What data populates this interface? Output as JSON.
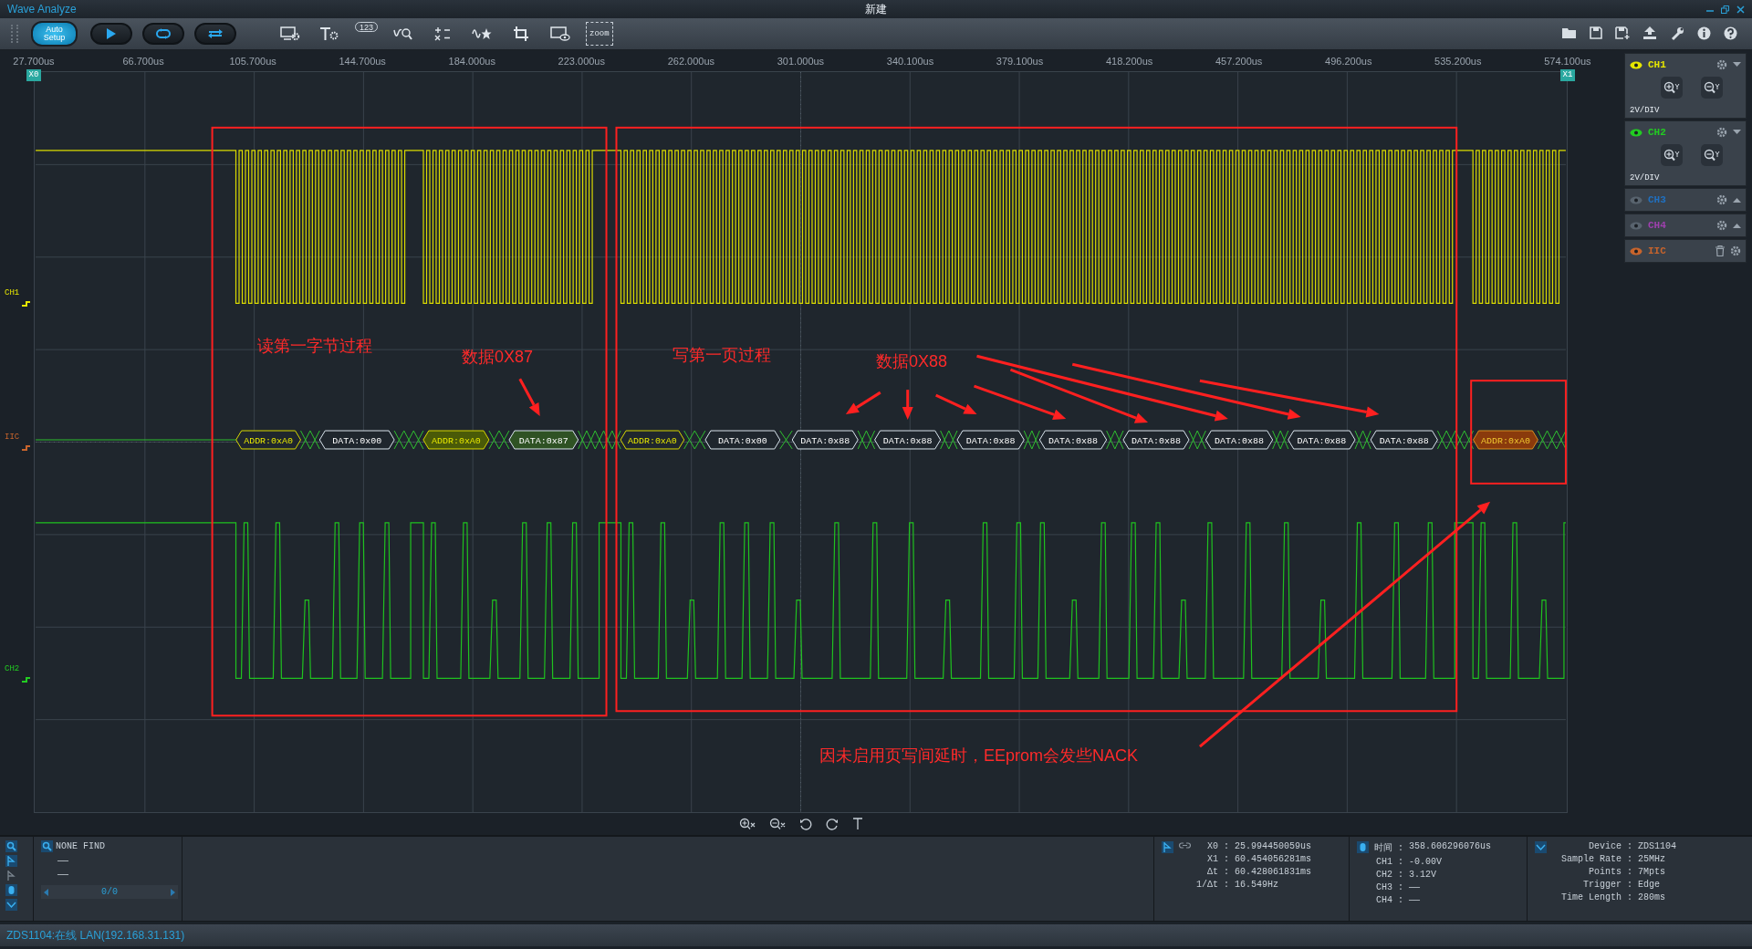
{
  "window": {
    "app_title": "Wave Analyze",
    "document_title": "新建"
  },
  "toolbar": {
    "auto_setup": "Auto Setup",
    "counter_badge": "123",
    "zoom_badge": "zoom"
  },
  "time_axis": {
    "labels": [
      "27.700us",
      "66.700us",
      "105.700us",
      "144.700us",
      "184.000us",
      "223.000us",
      "262.000us",
      "301.000us",
      "340.100us",
      "379.100us",
      "418.200us",
      "457.200us",
      "496.200us",
      "535.200us",
      "574.100us"
    ]
  },
  "cursors": [
    {
      "label": "X0"
    },
    {
      "label": "X1"
    }
  ],
  "trace_labels": [
    {
      "name": "CH1",
      "color": "#e6e600"
    },
    {
      "name": "IIC",
      "color": "#c8642c"
    },
    {
      "name": "CH2",
      "color": "#22cc22"
    }
  ],
  "decode": {
    "segments": [
      {
        "kind": "addr",
        "label": "ADDR:0xA0",
        "highlighted": false,
        "error": false
      },
      {
        "kind": "data",
        "label": "DATA:0x00",
        "highlighted": false,
        "error": false
      },
      {
        "kind": "addr",
        "label": "ADDR:0xA0",
        "highlighted": true,
        "error": false
      },
      {
        "kind": "data",
        "label": "DATA:0x87",
        "highlighted": true,
        "error": false
      },
      {
        "kind": "addr",
        "label": "ADDR:0xA0",
        "highlighted": false,
        "error": false
      },
      {
        "kind": "data",
        "label": "DATA:0x00",
        "highlighted": false,
        "error": false
      },
      {
        "kind": "data",
        "label": "DATA:0x88",
        "highlighted": false,
        "error": false
      },
      {
        "kind": "data",
        "label": "DATA:0x88",
        "highlighted": false,
        "error": false
      },
      {
        "kind": "data",
        "label": "DATA:0x88",
        "highlighted": false,
        "error": false
      },
      {
        "kind": "data",
        "label": "DATA:0x88",
        "highlighted": false,
        "error": false
      },
      {
        "kind": "data",
        "label": "DATA:0x88",
        "highlighted": false,
        "error": false
      },
      {
        "kind": "data",
        "label": "DATA:0x88",
        "highlighted": false,
        "error": false
      },
      {
        "kind": "data",
        "label": "DATA:0x88",
        "highlighted": false,
        "error": false
      },
      {
        "kind": "data",
        "label": "DATA:0x88",
        "highlighted": false,
        "error": false
      },
      {
        "kind": "addr",
        "label": "ADDR:0xA0",
        "highlighted": false,
        "error": true
      }
    ]
  },
  "annotations": [
    {
      "text": "读第一字节过程"
    },
    {
      "text": "数据0X87"
    },
    {
      "text": "写第一页过程"
    },
    {
      "text": "数据0X88"
    },
    {
      "text": "因未启用页写间延时，EEprom会发些NACK"
    }
  ],
  "channels": [
    {
      "name": "CH1",
      "kind": "analog",
      "visible": true,
      "expanded": true,
      "color": "#e6e600",
      "scale": "2V/DIV"
    },
    {
      "name": "CH2",
      "kind": "analog",
      "visible": true,
      "expanded": true,
      "color": "#22cc22",
      "scale": "2V/DIV"
    },
    {
      "name": "CH3",
      "kind": "analog",
      "visible": false,
      "expanded": false,
      "color": "#2070c0"
    },
    {
      "name": "CH4",
      "kind": "analog",
      "visible": false,
      "expanded": false,
      "color": "#a040b0"
    },
    {
      "name": "IIC",
      "kind": "bus",
      "visible": true,
      "expanded": false,
      "color": "#c8642c"
    }
  ],
  "search": {
    "status": "NONE FIND",
    "lines": [
      "——",
      "——"
    ],
    "page": "0/0"
  },
  "cursor_readout": [
    {
      "label": "X0 :",
      "value": "25.994450059us"
    },
    {
      "label": "X1 :",
      "value": "60.454056281ms"
    },
    {
      "label": "Δt :",
      "value": "60.428061831ms"
    },
    {
      "label": "1/Δt :",
      "value": "16.549Hz"
    }
  ],
  "probe_readout": [
    {
      "label": "时间 :",
      "value": "358.606296076us"
    },
    {
      "label": "CH1 :",
      "value": "-0.00V"
    },
    {
      "label": "CH2 :",
      "value": "3.12V"
    },
    {
      "label": "CH3 :",
      "value": "——"
    },
    {
      "label": "CH4 :",
      "value": "——"
    }
  ],
  "device_info": [
    {
      "label": "Device :",
      "value": "ZDS1104"
    },
    {
      "label": "Sample Rate :",
      "value": "25MHz"
    },
    {
      "label": "Points :",
      "value": "7Mpts"
    },
    {
      "label": "Trigger :",
      "value": "Edge"
    },
    {
      "label": "Time Length :",
      "value": "280ms"
    }
  ],
  "status_bar": "ZDS1104:在线 LAN(192.168.31.131)"
}
